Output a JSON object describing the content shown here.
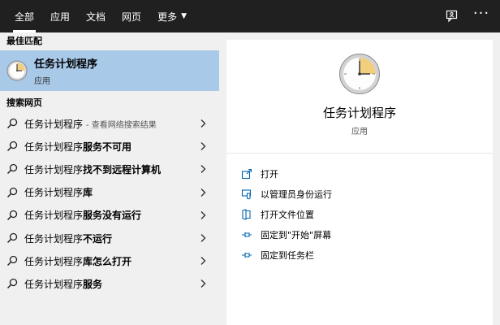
{
  "tabs": [
    {
      "label": "全部"
    },
    {
      "label": "应用"
    },
    {
      "label": "文档"
    },
    {
      "label": "网页"
    },
    {
      "label": "更多"
    }
  ],
  "header_icons": [
    "feedback-icon",
    "more-options-icon"
  ],
  "best_match": {
    "heading": "最佳匹配",
    "title": "任务计划程序",
    "subtitle": "应用",
    "icon": "clock-icon"
  },
  "web_search": {
    "heading": "搜索网页",
    "items": [
      {
        "query": "任务计划程序",
        "suffix": "",
        "hint": "- 查看网络搜索结果"
      },
      {
        "query": "任务计划程序",
        "suffix": "服务不可用",
        "hint": ""
      },
      {
        "query": "任务计划程序",
        "suffix": "找不到远程计算机",
        "hint": ""
      },
      {
        "query": "任务计划程序",
        "suffix": "库",
        "hint": ""
      },
      {
        "query": "任务计划程序",
        "suffix": "服务没有运行",
        "hint": ""
      },
      {
        "query": "任务计划程序",
        "suffix": " 不运行",
        "hint": ""
      },
      {
        "query": "任务计划程序",
        "suffix": "库怎么打开",
        "hint": ""
      },
      {
        "query": "任务计划程序",
        "suffix": "服务",
        "hint": ""
      }
    ]
  },
  "detail": {
    "title": "任务计划程序",
    "subtitle": "应用",
    "actions": [
      {
        "label": "打开",
        "icon": "open-icon"
      },
      {
        "label": "以管理员身份运行",
        "icon": "run-as-admin-icon"
      },
      {
        "label": "打开文件位置",
        "icon": "file-location-icon"
      },
      {
        "label": "固定到\"开始\"屏幕",
        "icon": "pin-icon"
      },
      {
        "label": "固定到任务栏",
        "icon": "pin-icon"
      }
    ]
  },
  "colors": {
    "topbar": "#202020",
    "highlight": "#a9c9e9",
    "accent": "#0063b1"
  }
}
